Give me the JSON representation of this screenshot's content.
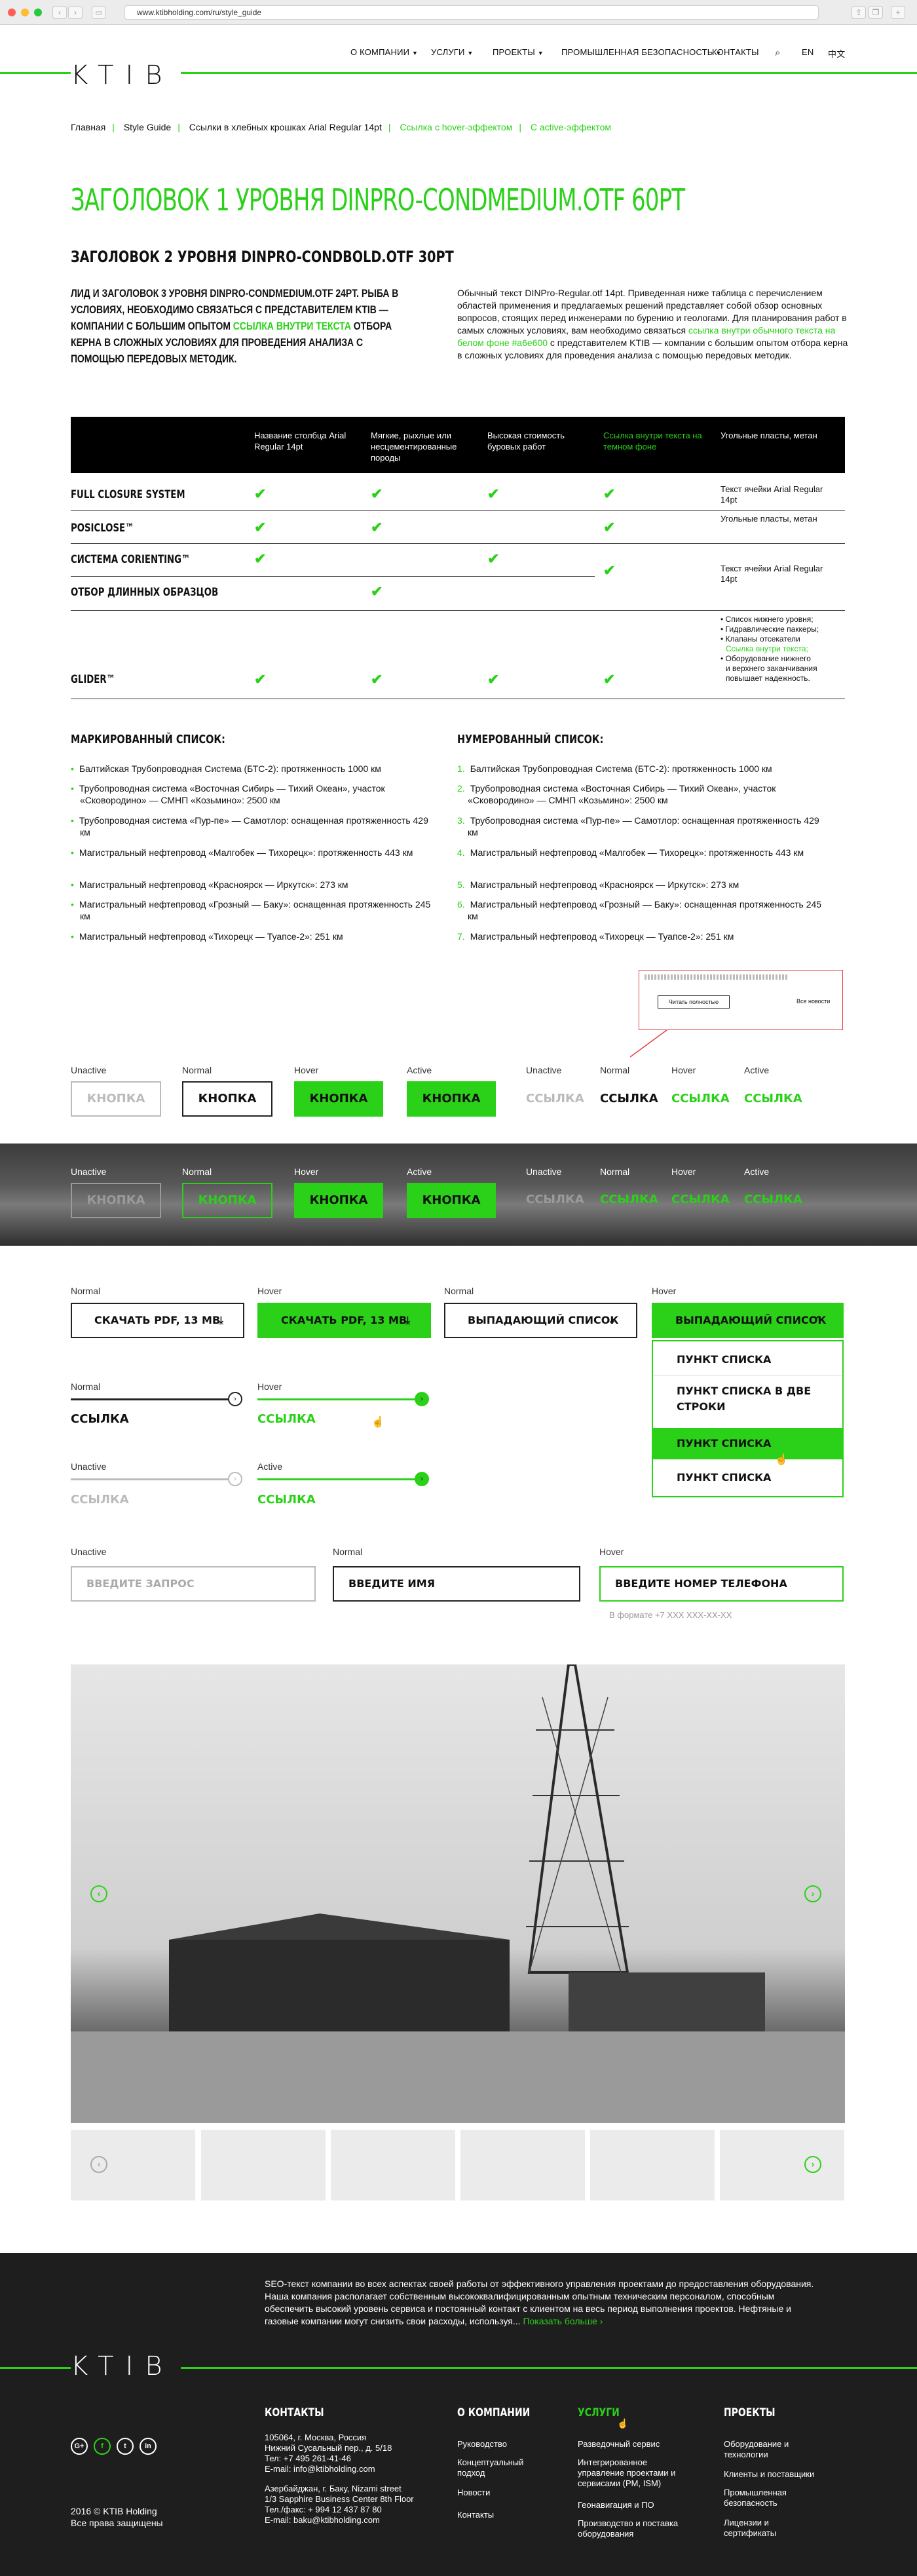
{
  "browser": {
    "url": "www.ktibholding.com/ru/style_guide"
  },
  "header": {
    "logo": "KTIB",
    "nav": [
      "О КОМПАНИИ",
      "УСЛУГИ",
      "ПРОЕКТЫ",
      "ПРОМЫШЛЕННАЯ БЕЗОПАСНОСТЬ",
      "КОНТАКТЫ"
    ],
    "lang_en": "EN",
    "lang_cn": "中文"
  },
  "breadcrumbs": [
    "Главная",
    "Style Guide",
    "Ссылки в хлебных крошках Arial Regular 14pt",
    "Ссылка с hover-эффектом",
    "С active-эффектом"
  ],
  "headings": {
    "h1": "ЗАГОЛОВОК 1 УРОВНЯ DINPRO-CONDMEDIUM.OTF 60PT",
    "h2": "ЗАГОЛОВОК 2 УРОВНЯ DINPRO-CONDBOLD.OTF 30PT"
  },
  "lead": {
    "text": "ЛИД И ЗАГОЛОВОК 3 УРОВНЯ DINPRO-CONDMEDIUM.OTF 24PT. РЫБА В УСЛОВИЯХ, НЕОБХОДИМО СВЯЗАТЬСЯ С ПРЕДСТАВИТЕЛЕМ KTIB — КОМПАНИИ С БОЛЬШИМ ОПЫТОМ ",
    "link": "ССЫЛКА ВНУТРИ ТЕКСТА",
    "tail": " ОТБОРА КЕРНА В СЛОЖНЫХ УСЛОВИЯХ ДЛЯ ПРОВЕДЕНИЯ АНАЛИЗА С ПОМОЩЬЮ ПЕРЕДОВЫХ МЕТОДИК."
  },
  "body_text": {
    "part1": "Обычный текст DINPro-Regular.otf 14pt. Приведенная ниже таблица с перечислением областей применения и предлагаемых решений представляет собой обзор основных вопросов, стоящих перед инженерами по бурению и геологами. Для планирования работ в самых сложных условиях, вам необходимо связаться ",
    "link": "ссылка внутри обычного текста на белом фоне #a6e600",
    "part2": " с представителем KTIB — компании с большим опытом отбора керна в сложных условиях для проведения анализа с помощью передовых методик."
  },
  "table": {
    "headers": [
      "Название столбца Arial Regular 14pt",
      "Мягкие, рыхлые или несцементированные породы",
      "Высокая стоимость буровых работ",
      "Ссылка внутри текста на темном фоне",
      "Угольные пласты, метан"
    ],
    "rows": [
      "FULL CLOSURE SYSTEM",
      "POSICLOSE™",
      "СИСТЕМА CORIENTING™",
      "ОТБОР ДЛИННЫХ ОБРАЗЦОВ",
      "GLIDER™"
    ],
    "cell_texts": [
      "Текст ячейки Arial Regular 14pt",
      "Угольные пласты, метан",
      "Текст ячейки Arial Regular 14pt"
    ],
    "glider_list": [
      "Список нижнего уровня;",
      "Гидравлические паккеры;",
      "Клапаны отсекатели",
      "Ссылка внутри текста;",
      "Оборудование нижнего",
      "и верхнего заканчивания",
      "повышает надежность."
    ],
    "check": "✔"
  },
  "lists": {
    "marked_title": "МАРКИРОВАННЫЙ СПИСОК:",
    "numbered_title": "НУМЕРОВАННЫЙ СПИСОК:",
    "items": [
      "Балтийская Трубопроводная Система (БТС-2): протяженность 1000 км",
      "Трубопроводная система «Восточная Сибирь — Тихий Океан», участок «Сковородино» — СМНП «Козьмино»: 2500 км",
      "Трубопроводная система «Пур-пе» — Самотлор: оснащенная протяженность 429 км",
      "Магистральный нефтепровод «Малгобек — Тихорецк»: протяженность 443 км",
      "Магистральный нефтепровод «Красноярск — Иркутск»: 273 км",
      "Магистральный нефтепровод «Грозный — Баку»: оснащенная протяженность 245 км",
      "Магистральный нефтепровод «Тихорецк — Туапсе-2»: 251 км"
    ]
  },
  "mini_preview": {
    "btn": "Читать полностью",
    "link": "Все новости"
  },
  "states": {
    "unactive": "Unactive",
    "normal": "Normal",
    "hover": "Hover",
    "active": "Active"
  },
  "buttons": {
    "button": "КНОПКА",
    "link": "ССЫЛКА"
  },
  "controls": {
    "download": "СКАЧАТЬ PDF, 13 MB",
    "dropdown": "ВЫПАДАЮЩИЙ СПИСОК",
    "dd_items": [
      "ПУНКТ СПИСКА",
      "ПУНКТ СПИСКА В ДВЕ СТРОКИ",
      "ПУНКТ СПИСКА",
      "ПУНКТ СПИСКА"
    ],
    "link": "ССЫЛКА"
  },
  "inputs": {
    "query": "ВВЕДИТЕ ЗАПРОС",
    "name": "ВВЕДИТЕ ИМЯ",
    "phone": "ВВЕДИТЕ НОМЕР ТЕЛЕФОНА",
    "phone_hint": "В формате +7 XXX XXX-XX-XX"
  },
  "seo": {
    "text": "SEO-текст компании во всех аспектах своей работы от эффективного управления проектами до предоставления оборудования. Наша компания располагает собственным высококвалифицированным опытным техническим персоналом, способным обеспечить высокий уровень сервиса и постоянный контакт с клиентом на весь период выполнения проектов. Нефтяные и газовые компании могут снизить свои расходы, используя...",
    "more": "Показать больше ›"
  },
  "footer": {
    "logo": "KTIB",
    "copyright": "2016 © KTIB Holding",
    "rights": "Все права защищены",
    "social": [
      "G+",
      "f",
      "t",
      "in"
    ],
    "contacts_title": "КОНТАКТЫ",
    "contacts": [
      "105064, г. Москва, Россия",
      "Нижний Сусальный пер., д. 5/18",
      "Тел: +7 495 261-41-46",
      "E-mail: info@ktibholding.com",
      "",
      "Азербайджан, г. Баку, Nizami street",
      "1/3 Sapphire Business Center 8th Floor",
      "Тел./факс: + 994 12 437 87 80",
      "E-mail: baku@ktibholding.com"
    ],
    "company_title": "О КОМПАНИИ",
    "company": [
      "Руководство",
      "Концептуальный подход",
      "Новости",
      "Контакты"
    ],
    "services_title": "УСЛУГИ",
    "services": [
      "Разведочный сервис",
      "Интегрированное управление проектами и сервисами (PM, ISM)",
      "Геонавигация и ПО",
      "Производство и поставка оборудования"
    ],
    "projects_title": "ПРОЕКТЫ",
    "projects": [
      "Оборудование и технологии",
      "Клиенты и поставщики",
      "Промышленная безопасность",
      "Лицензии и сертификаты"
    ]
  },
  "colors": {
    "accent": "#2bd119",
    "dark": "#1e1e1e"
  }
}
